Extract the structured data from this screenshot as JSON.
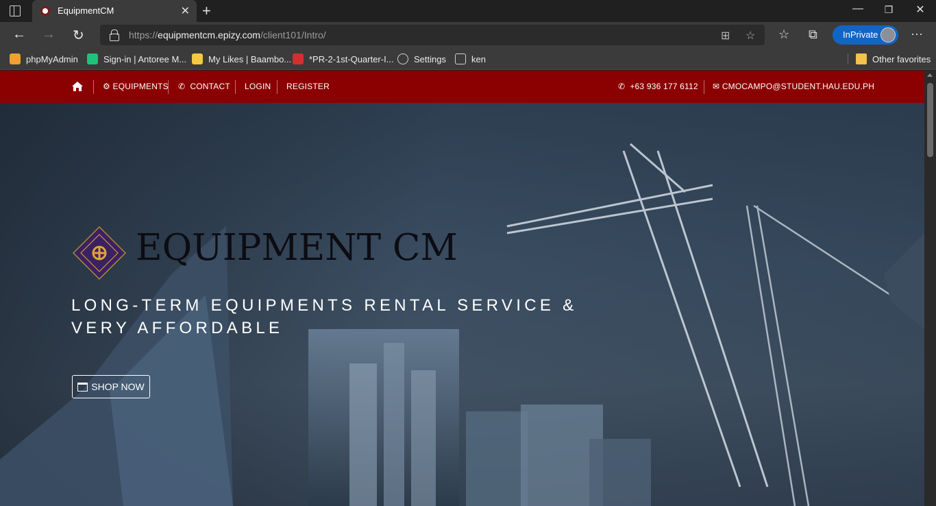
{
  "browser": {
    "tab_title": "EquipmentCM",
    "url_host_prefix": "https://",
    "url_host": "equipmentcm.epizy.com",
    "url_path": "/client101/Intro/",
    "inprivate_label": "InPrivate",
    "favorites": [
      {
        "label": "phpMyAdmin",
        "icon": "phpmyadmin-icon",
        "color": "#f0a030"
      },
      {
        "label": "Sign-in | Antoree M...",
        "icon": "antoree-icon",
        "color": "#1ec27a"
      },
      {
        "label": "My Likes | Baambo...",
        "icon": "baamboozle-icon",
        "color": "#f5c842"
      },
      {
        "label": "*PR-2-1st-Quarter-I...",
        "icon": "pdf-icon",
        "color": "#d32f2f"
      },
      {
        "label": "Settings",
        "icon": "gear-icon",
        "color": "#cfcfcf"
      },
      {
        "label": "ken",
        "icon": "page-icon",
        "color": "#cfcfcf"
      }
    ],
    "other_favorites": "Other favorites"
  },
  "site": {
    "nav": {
      "equipments": "EQUIPMENTS",
      "contact": "CONTACT",
      "login": "LOGIN",
      "register": "REGISTER",
      "phone": "+63 936 177 6112",
      "email": "CMOCAMPO@STUDENT.HAU.EDU.PH"
    },
    "brand": "EQUIPMENT CM",
    "tagline": "LONG-TERM EQUIPMENTS RENTAL SERVICE & VERY AFFORDABLE",
    "cta": "SHOP NOW",
    "colors": {
      "nav_bg": "#8b0000",
      "emblem": "#3a2260",
      "emblem_gold": "#e2a43a"
    }
  }
}
